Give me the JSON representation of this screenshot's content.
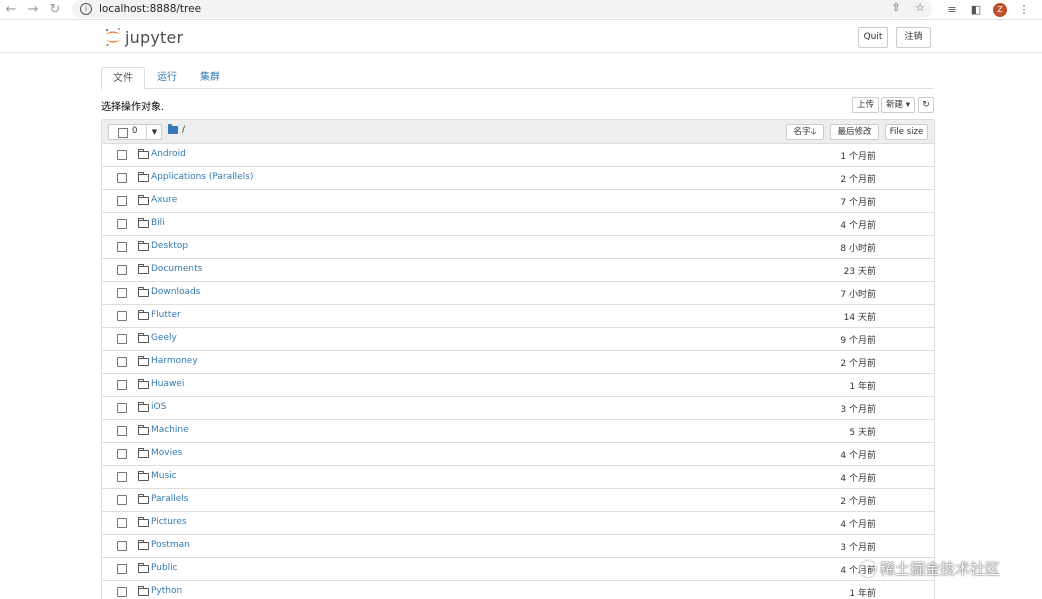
{
  "browser": {
    "url": "localhost:8888/tree",
    "avatar_letter": "Z"
  },
  "header": {
    "logo_text": "jupyter",
    "quit_label": "Quit",
    "logout_label": "注销"
  },
  "tabs": [
    {
      "label": "文件",
      "active": true
    },
    {
      "label": "运行",
      "active": false
    },
    {
      "label": "集群",
      "active": false
    }
  ],
  "toolbar": {
    "select_text": "选择操作对象.",
    "upload_label": "上传",
    "new_label": "新建",
    "selected_count": "0",
    "path_separator": "/",
    "sort_name_label": "名字",
    "sort_modified_label": "最后修改",
    "sort_size_label": "File size"
  },
  "files": [
    {
      "name": "Android",
      "modified": "1 个月前"
    },
    {
      "name": "Applications (Parallels)",
      "modified": "2 个月前"
    },
    {
      "name": "Axure",
      "modified": "7 个月前"
    },
    {
      "name": "Bili",
      "modified": "4 个月前"
    },
    {
      "name": "Desktop",
      "modified": "8 小时前"
    },
    {
      "name": "Documents",
      "modified": "23 天前"
    },
    {
      "name": "Downloads",
      "modified": "7 小时前"
    },
    {
      "name": "Flutter",
      "modified": "14 天前"
    },
    {
      "name": "Geely",
      "modified": "9 个月前"
    },
    {
      "name": "Harmoney",
      "modified": "2 个月前"
    },
    {
      "name": "Huawei",
      "modified": "1 年前"
    },
    {
      "name": "iOS",
      "modified": "3 个月前"
    },
    {
      "name": "Machine",
      "modified": "5 天前"
    },
    {
      "name": "Movies",
      "modified": "4 个月前"
    },
    {
      "name": "Music",
      "modified": "4 个月前"
    },
    {
      "name": "Parallels",
      "modified": "2 个月前"
    },
    {
      "name": "Pictures",
      "modified": "4 个月前"
    },
    {
      "name": "Postman",
      "modified": "3 个月前"
    },
    {
      "name": "Public",
      "modified": "4 个月前"
    },
    {
      "name": "Python",
      "modified": "1 年前"
    }
  ],
  "watermark": "稀土掘金技术社区"
}
